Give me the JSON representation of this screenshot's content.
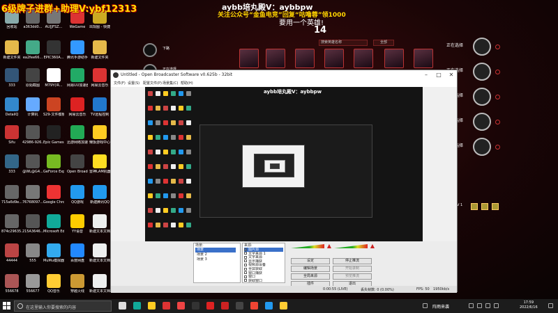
{
  "overlay": {
    "top_left": "6级牌子进群+助理V:ybf12313",
    "top_center": "aybb培丸殿V：aybbpw",
    "promo": "关注公众号“金鱼电竞”回复“咕噜蓉”领1000",
    "banner": "要用一个英雄!",
    "count": "14"
  },
  "desktop": {
    "icons": [
      {
        "label": "回收站",
        "color": "#8aa"
      },
      {
        "label": "a363dd0...",
        "color": "#666"
      },
      {
        "label": "AU[JFSZ...",
        "color": "#777"
      },
      {
        "label": "WeGame",
        "color": "#d33"
      },
      {
        "label": "出现图 - 快捷方式",
        "color": "#ca2"
      },
      {
        "label": "新建文本文档(5)",
        "color": "#eee"
      },
      {
        "label": "新建文件夹",
        "color": "#e5b94a"
      },
      {
        "label": "ea2fee66...",
        "color": "#4a8"
      },
      {
        "label": "EPIC360A...",
        "color": "#333"
      },
      {
        "label": "腾讯手游助手(优化版)",
        "color": "#39f"
      },
      {
        "label": "新建文件夹",
        "color": "#e5b94a"
      },
      {
        "label": "新建文本文档",
        "color": "#eee"
      },
      {
        "label": "333",
        "color": "#357"
      },
      {
        "label": "原始截图",
        "color": "#444"
      },
      {
        "label": "M79Y(IR...",
        "color": "#fff"
      },
      {
        "label": "网易UU加速器",
        "color": "#2a6"
      },
      {
        "label": "网易云音乐",
        "color": "#d33"
      },
      {
        "label": "新建文本文档",
        "color": "#eee"
      },
      {
        "label": "DetailQ",
        "color": "#38c"
      },
      {
        "label": "计算机",
        "color": "#6af"
      },
      {
        "label": "S29-文件模板",
        "color": "#c42"
      },
      {
        "label": "网易云音乐",
        "color": "#d22"
      },
      {
        "label": "TV远程控制",
        "color": "#27c"
      },
      {
        "label": "",
        "color": "#eee"
      },
      {
        "label": "Sifu",
        "color": "#c33"
      },
      {
        "label": "42986-926...",
        "color": "#555"
      },
      {
        "label": "Epic Games Launcher",
        "color": "#222"
      },
      {
        "label": "迅游网络加速",
        "color": "#2a5"
      },
      {
        "label": "懒饭游戏中心",
        "color": "#fc2"
      },
      {
        "label": "",
        "color": "#eee"
      },
      {
        "label": "333",
        "color": "#368"
      },
      {
        "label": "@WL@G4...",
        "color": "#555"
      },
      {
        "label": "GeForce Experience",
        "color": "#7b2"
      },
      {
        "label": "Open Broadcast...",
        "color": "#444"
      },
      {
        "label": "雷神LAM机器",
        "color": "#fd2"
      },
      {
        "label": "",
        "color": "#eee"
      },
      {
        "label": "715a6d9e...",
        "color": "#666"
      },
      {
        "label": "76768097...",
        "color": "#777"
      },
      {
        "label": "Google Chrome",
        "color": "#e33"
      },
      {
        "label": "QQ游戏",
        "color": "#29e"
      },
      {
        "label": "新建腾讯QQ",
        "color": "#29e"
      },
      {
        "label": "",
        "color": "#eee"
      },
      {
        "label": "874c29635...",
        "color": "#666"
      },
      {
        "label": "215A3646...",
        "color": "#555"
      },
      {
        "label": "Microsoft Edge",
        "color": "#1a9"
      },
      {
        "label": "YY语音",
        "color": "#fc0"
      },
      {
        "label": "新建文本文档(2)",
        "color": "#eee"
      },
      {
        "label": "",
        "color": "#eee"
      },
      {
        "label": "44444",
        "color": "#b44"
      },
      {
        "label": "555",
        "color": "#888"
      },
      {
        "label": "MuMu模拟器",
        "color": "#3ae"
      },
      {
        "label": "百度网盘",
        "color": "#28f"
      },
      {
        "label": "新建文本文档(3)",
        "color": "#eee"
      },
      {
        "label": "",
        "color": "#eee"
      },
      {
        "label": "556678",
        "color": "#a55"
      },
      {
        "label": "556677",
        "color": "#999"
      },
      {
        "label": "QQ音乐",
        "color": "#fc3"
      },
      {
        "label": "穿越火线",
        "color": "#c93"
      },
      {
        "label": "新建文本文档(4)",
        "color": "#eee"
      }
    ]
  },
  "game": {
    "search_placeholder": "搜索英雄名称",
    "filter": "全部",
    "pick_label": "下路",
    "pick_label2": "正在选择"
  },
  "right_panel": {
    "rows": [
      {
        "label": "正在选择"
      },
      {
        "label": "正在选择"
      },
      {
        "label": "正在选择"
      },
      {
        "label": "正在选择"
      },
      {
        "label": "正在选择"
      }
    ],
    "ctl_label": "V 1"
  },
  "obs": {
    "title": "Untitled - Open Broadcaster Software v0.625b - 32bit",
    "menu": [
      "文件(F)",
      "设置(S)",
      "配置文件(P)",
      "场景集(C)",
      "帮助(H)"
    ],
    "preview_overlay": "aybb培丸殿V：aybbpw",
    "scenes_title": "场景:",
    "scenes": [
      "场景",
      "场景 2",
      "场景 3"
    ],
    "sources_title": "来源:",
    "sources": [
      "图片源",
      "文字来源 1",
      "文字来源",
      "显示捕获",
      "视频源设备",
      "全屏获取",
      "窗口捕获",
      "窗口",
      "获取窗口"
    ],
    "buttons": {
      "settings": "设定",
      "stop_stream": "停止推流",
      "edit_scene": "编辑场景",
      "start_recording": "开始录制",
      "global_sources": "全局来源",
      "preview_stream": "预览推流",
      "plugins": "插件",
      "exit": "退出"
    },
    "status": {
      "time": "0:00:55 (LIVE)",
      "dropped": "丢失帧数: 0 (0.00%)",
      "fps": "FPS: 50",
      "kbps": "1950kb/s"
    }
  },
  "taskbar": {
    "search_placeholder": "在这里输入你要搜索的内容",
    "tray_text": "阵雨来袭",
    "time": "17:59",
    "date": "2022/6/16",
    "apps": [
      {
        "name": "task-view-icon",
        "color": "#ddd"
      },
      {
        "name": "edge-icon",
        "color": "#1a9"
      },
      {
        "name": "explorer-icon",
        "color": "#fc2"
      },
      {
        "name": "app-red-icon",
        "color": "#d33"
      },
      {
        "name": "app-redhat-icon",
        "color": "#e44"
      },
      {
        "name": "app-black-icon",
        "color": "#333"
      },
      {
        "name": "wegame-icon",
        "color": "#d22"
      },
      {
        "name": "netease-icon",
        "color": "#c22"
      },
      {
        "name": "obs-icon",
        "color": "#444"
      },
      {
        "name": "chrome-icon",
        "color": "#e43"
      },
      {
        "name": "qq-icon",
        "color": "#29e"
      },
      {
        "name": "g-icon",
        "color": "#fc3"
      }
    ]
  }
}
